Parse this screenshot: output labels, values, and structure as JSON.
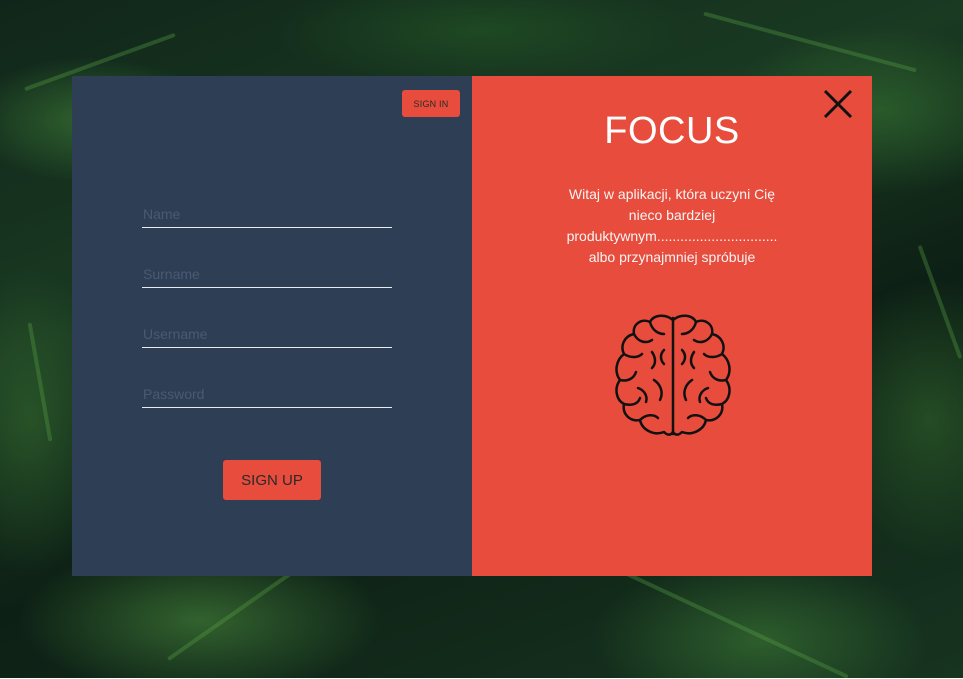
{
  "background": {
    "description_icon": "fern-leaves-background"
  },
  "left_panel": {
    "signin_label": "SIGN IN",
    "fields": {
      "name_placeholder": "Name",
      "surname_placeholder": "Surname",
      "username_placeholder": "Username",
      "password_placeholder": "Password"
    },
    "signup_label": "SIGN UP"
  },
  "right_panel": {
    "title": "FOCUS",
    "description": "Witaj w aplikacji, która uczyni Cię nieco bardziej produktywnym............................... albo przynajmniej spróbuje",
    "close_icon": "close-icon",
    "illustration_icon": "brain-icon"
  },
  "colors": {
    "left_panel_bg": "#2e3e55",
    "accent": "#e74c3c",
    "text_light": "#ffffff",
    "icon_dark": "#111111"
  }
}
